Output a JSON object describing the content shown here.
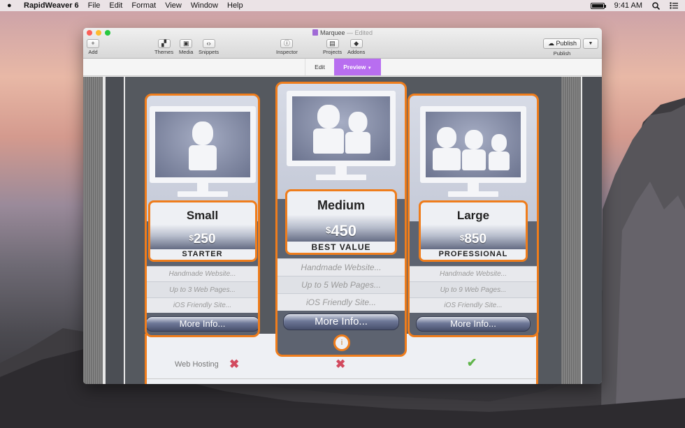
{
  "menubar": {
    "app_name": "RapidWeaver 6",
    "items": [
      "File",
      "Edit",
      "Format",
      "View",
      "Window",
      "Help"
    ],
    "clock": "9:41 AM"
  },
  "window": {
    "title": "Marquee",
    "edited": "— Edited",
    "toolbar": {
      "add": "Add",
      "themes": "Themes",
      "media": "Media",
      "snippets": "Snippets",
      "inspector": "Inspector",
      "projects": "Projects",
      "addons": "Addons",
      "publish_button": "Publish",
      "publish_label": "Publish"
    },
    "modes": {
      "edit": "Edit",
      "preview": "Preview"
    }
  },
  "pricing": {
    "plans": [
      {
        "name": "Small",
        "currency": "$",
        "price": "250",
        "tier": "STARTER",
        "features": [
          "Handmade Website...",
          "Up to 3 Web Pages...",
          "iOS Friendly Site..."
        ],
        "more": "More Info...",
        "web_hosting": "no"
      },
      {
        "name": "Medium",
        "currency": "$",
        "price": "450",
        "tier": "BEST VALUE",
        "features": [
          "Handmade Website...",
          "Up to 5 Web Pages...",
          "iOS Friendly Site..."
        ],
        "more": "More Info...",
        "web_hosting": "no"
      },
      {
        "name": "Large",
        "currency": "$",
        "price": "850",
        "tier": "PROFESSIONAL",
        "features": [
          "Handmade Website...",
          "Up to 9 Web Pages...",
          "iOS Friendly Site..."
        ],
        "more": "More Info...",
        "web_hosting": "yes"
      }
    ],
    "row_label": "Web Hosting",
    "info_glyph": "i"
  },
  "colors": {
    "accent": "#ef7d1c",
    "preview_tab": "#b86ef0",
    "cross": "#d24a5e",
    "check": "#5fb44a"
  }
}
